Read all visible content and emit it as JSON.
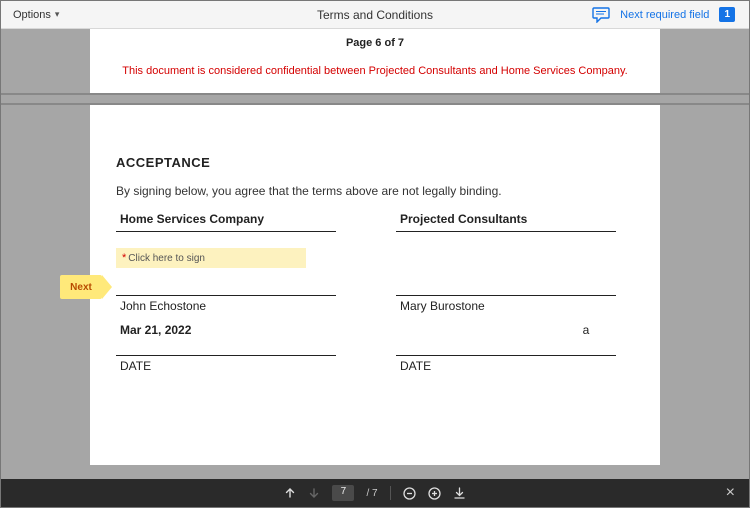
{
  "header": {
    "options_label": "Options",
    "title": "Terms and Conditions",
    "next_link": "Next required field",
    "badge_count": "1"
  },
  "page_top": {
    "page_label": "Page 6 of 7",
    "confidential": "This document is considered confidential between Projected Consultants and Home Services Company."
  },
  "doc": {
    "acceptance_title": "ACCEPTANCE",
    "agree_text": "By signing below, you agree that the terms above are not legally binding.",
    "left": {
      "header": "Home Services Company",
      "sign_placeholder": "Click here to sign",
      "name": "John Echostone",
      "date_value": "Mar 21, 2022",
      "date_label": "DATE"
    },
    "right": {
      "header": "Projected Consultants",
      "name": "Mary Burostone",
      "date_value": "a",
      "date_label": "DATE"
    }
  },
  "next_flag": "Next",
  "footer": {
    "current_page": "7",
    "total_pages": "/ 7"
  }
}
